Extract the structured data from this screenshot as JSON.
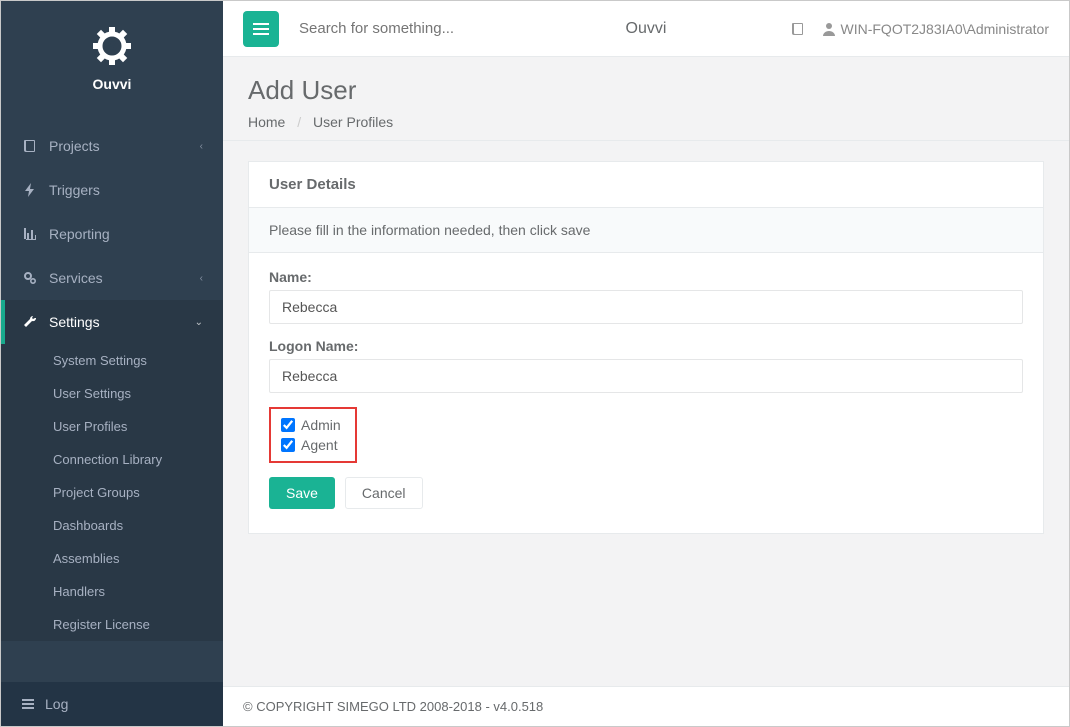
{
  "brand": "Ouvvi",
  "topbar": {
    "search_placeholder": "Search for something...",
    "center_title": "Ouvvi",
    "user_label": "WIN-FQOT2J83IA0\\Administrator"
  },
  "sidebar": {
    "items": [
      {
        "label": "Projects",
        "expandable": true
      },
      {
        "label": "Triggers",
        "expandable": false
      },
      {
        "label": "Reporting",
        "expandable": false
      },
      {
        "label": "Services",
        "expandable": true
      },
      {
        "label": "Settings",
        "expandable": true,
        "active": true
      }
    ],
    "settings_children": [
      {
        "label": "System Settings"
      },
      {
        "label": "User Settings"
      },
      {
        "label": "User Profiles"
      },
      {
        "label": "Connection Library"
      },
      {
        "label": "Project Groups"
      },
      {
        "label": "Dashboards"
      },
      {
        "label": "Assemblies"
      },
      {
        "label": "Handlers"
      },
      {
        "label": "Register License"
      }
    ],
    "footer_label": "Log"
  },
  "page": {
    "title": "Add User",
    "crumb_home": "Home",
    "crumb_current": "User Profiles"
  },
  "panel": {
    "heading": "User Details",
    "info": "Please fill in the information needed, then click save",
    "name_label": "Name:",
    "name_value": "Rebecca",
    "logon_label": "Logon Name:",
    "logon_value": "Rebecca",
    "admin_label": "Admin",
    "admin_checked": true,
    "agent_label": "Agent",
    "agent_checked": true,
    "save_label": "Save",
    "cancel_label": "Cancel"
  },
  "footer": "© COPYRIGHT SIMEGO LTD 2008-2018 - v4.0.518"
}
